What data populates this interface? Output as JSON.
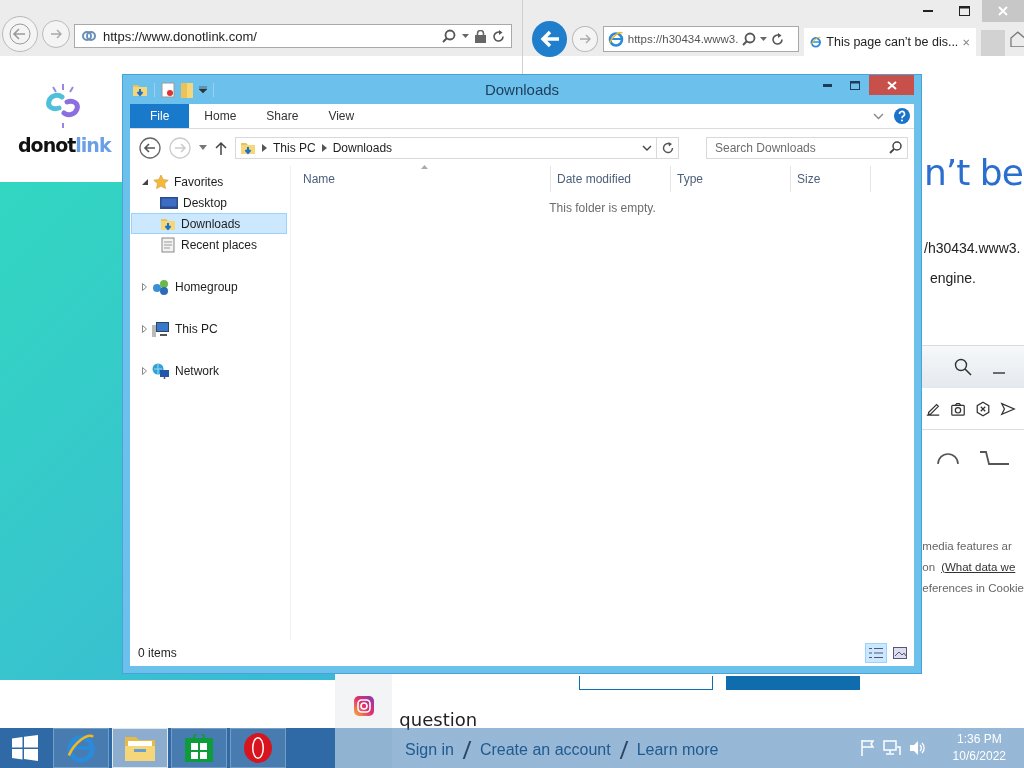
{
  "left_browser": {
    "address": "https://www.donotlink.com/",
    "logo": [
      "donot",
      "link"
    ]
  },
  "right_browser": {
    "address": "https://h30434.www3.",
    "tabs": [
      {
        "title": "This page can’t be dis...",
        "selected": true
      }
    ],
    "heading": "n’t be",
    "lines": [
      "/h30434.www3.",
      "engine."
    ]
  },
  "opera_window": {
    "consent_lines": [
      {
        "text": "media features ar"
      },
      {
        "text": "on",
        "link": "(What data we"
      },
      {
        "text": "eferences in Cookie"
      }
    ],
    "question": "question",
    "footer_links": [
      "Sign in",
      "Create an account",
      "Learn more"
    ]
  },
  "explorer": {
    "title": "Downloads",
    "ribbon_tabs": [
      {
        "label": "File",
        "kind": "file"
      },
      {
        "label": "Home",
        "kind": "tab"
      },
      {
        "label": "Share",
        "kind": "tab"
      },
      {
        "label": "View",
        "kind": "tab"
      }
    ],
    "breadcrumb": [
      "This PC",
      "Downloads"
    ],
    "search": {
      "placeholder": "Search Downloads"
    },
    "nav": [
      {
        "label": "Favorites",
        "kind": "favorites",
        "expanded": true,
        "selected": false,
        "children": [
          {
            "label": "Desktop",
            "kind": "desktop",
            "selected": false
          },
          {
            "label": "Downloads",
            "kind": "downloads",
            "selected": true
          },
          {
            "label": "Recent places",
            "kind": "recent",
            "selected": false
          }
        ]
      },
      {
        "label": "Homegroup",
        "kind": "homegroup",
        "expanded": false,
        "selected": false
      },
      {
        "label": "This PC",
        "kind": "pc",
        "expanded": false,
        "selected": false
      },
      {
        "label": "Network",
        "kind": "network",
        "expanded": false,
        "selected": false
      }
    ],
    "columns": [
      "Name",
      "Date modified",
      "Type",
      "Size"
    ],
    "empty_message": "This folder is empty.",
    "status": "0 items",
    "views": [
      {
        "kind": "details",
        "selected": true
      },
      {
        "kind": "tiles",
        "selected": false
      }
    ]
  },
  "taskbar": {
    "apps": [
      {
        "kind": "ie",
        "selected": false
      },
      {
        "kind": "explorer",
        "selected": true
      },
      {
        "kind": "store",
        "selected": false
      },
      {
        "kind": "opera",
        "selected": false
      }
    ],
    "clock": {
      "time": "1:36 PM",
      "date": "10/6/2022"
    }
  }
}
